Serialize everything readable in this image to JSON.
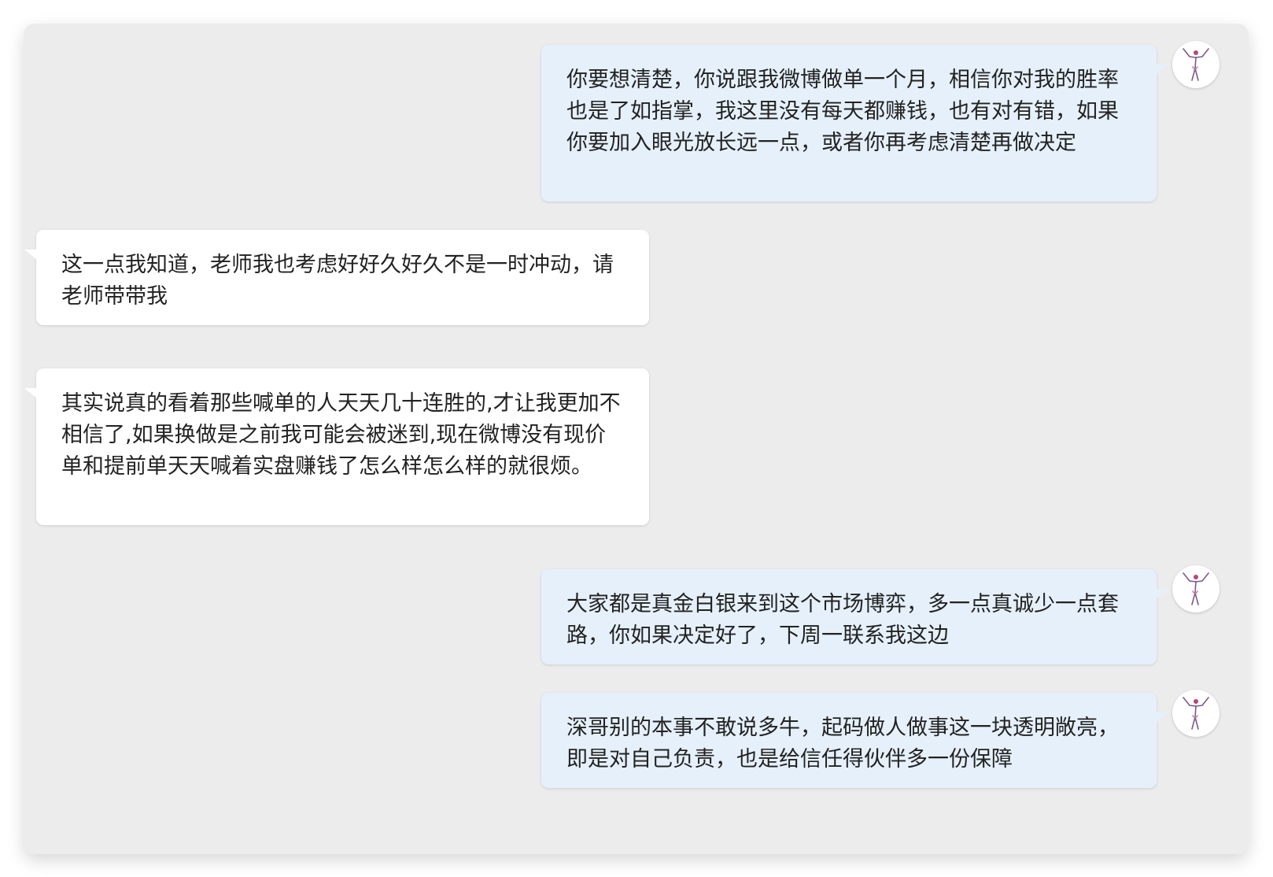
{
  "messages": [
    {
      "side": "outgoing",
      "text": "你要想清楚，你说跟我微博做单一个月，相信你对我的胜率也是了如指掌，我这里没有每天都赚钱，也有对有错，如果你要加入眼光放长远一点，或者你再考虑清楚再做决定"
    },
    {
      "side": "incoming",
      "text": "这一点我知道，老师我也考虑好好久好久不是一时冲动，请老师带带我"
    },
    {
      "side": "incoming",
      "text": "其实说真的看着那些喊单的人天天几十连胜的,才让我更加不相信了,如果换做是之前我可能会被迷到,现在微博没有现价单和提前单天天喊着实盘赚钱了怎么样怎么样的就很烦。"
    },
    {
      "side": "outgoing",
      "text": "大家都是真金白银来到这个市场博弈，多一点真诚少一点套路，你如果决定好了，下周一联系我这边"
    },
    {
      "side": "outgoing",
      "text": "深哥别的本事不敢说多牛，起码做人做事这一块透明敞亮，即是对自己负责，也是给信任得伙伴多一份保障"
    }
  ],
  "colors": {
    "panel_bg": "#ececec",
    "incoming_bubble": "#ffffff",
    "outgoing_bubble": "#e6f0fb",
    "avatar_figure": "#7a5a8c"
  },
  "avatar_icon": "dancer-figure-icon"
}
